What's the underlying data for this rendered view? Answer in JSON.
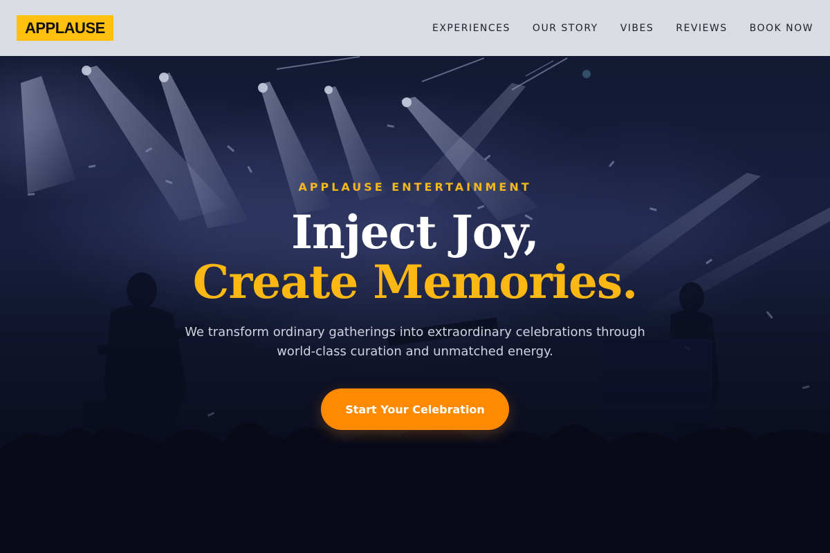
{
  "header": {
    "logo": "APPLAUSE",
    "nav": [
      {
        "label": "EXPERIENCES"
      },
      {
        "label": "OUR STORY"
      },
      {
        "label": "VIBES"
      },
      {
        "label": "REVIEWS"
      },
      {
        "label": "BOOK NOW"
      }
    ]
  },
  "hero": {
    "eyebrow": "APPLAUSE ENTERTAINMENT",
    "headline_line1": "Inject Joy,",
    "headline_line2": "Create Memories.",
    "subtext": "We transform ordinary gatherings into extraordinary celebrations through world-class curation and unmatched energy.",
    "cta_label": "Start Your Celebration",
    "background_image": "concert-stage-crowd"
  },
  "colors": {
    "accent_yellow": "#ffc10e",
    "headline_yellow": "#fbb814",
    "cta_orange": "#ff8a00",
    "header_bg": "#e2e4e8",
    "hero_bg": "#0b0f22"
  }
}
